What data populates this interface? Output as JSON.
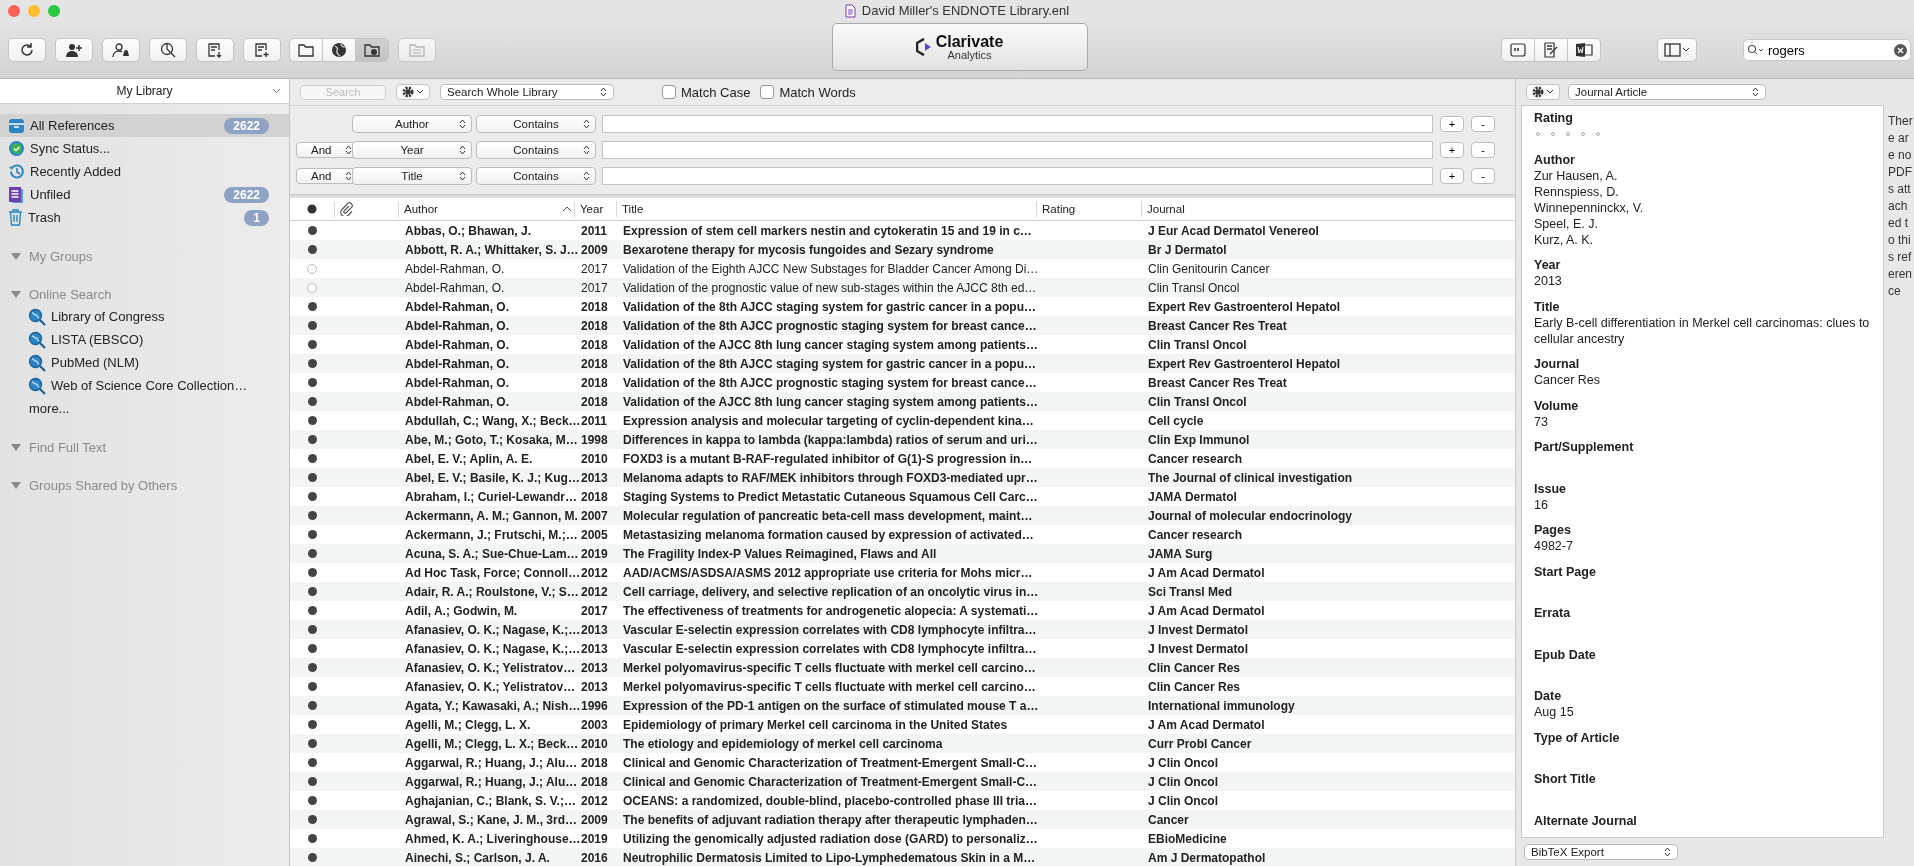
{
  "window": {
    "title": "David Miller's ENDNOTE Library.enl"
  },
  "toolbar": {
    "mode_buttons": [
      {
        "kind": "local",
        "selected": false
      },
      {
        "kind": "online",
        "selected": false
      },
      {
        "kind": "integrated",
        "selected": true
      }
    ],
    "logo": {
      "line1": "Clarivate",
      "line2": "Analytics"
    },
    "search": {
      "value": "rogers"
    }
  },
  "sidebar": {
    "library": "My Library",
    "items": [
      {
        "kind": "all",
        "label": "All References",
        "count": "2622",
        "selected": true
      },
      {
        "kind": "sync",
        "label": "Sync Status...",
        "selected": false
      },
      {
        "kind": "recent",
        "label": "Recently Added",
        "selected": false
      },
      {
        "kind": "unfiled",
        "label": "Unfiled",
        "count": "2622",
        "selected": false
      },
      {
        "kind": "trash",
        "label": "Trash",
        "count": "1",
        "selected": false
      }
    ],
    "groups": [
      {
        "title": "My Groups",
        "expanded": true
      },
      {
        "title": "Online Search",
        "expanded": true,
        "items": [
          {
            "kind": "source",
            "label": "Library of Congress"
          },
          {
            "kind": "source",
            "label": "LISTA (EBSCO)"
          },
          {
            "kind": "source",
            "label": "PubMed (NLM)"
          },
          {
            "kind": "source",
            "label": "Web of Science Core Collection…"
          },
          {
            "kind": "more",
            "label": "more..."
          }
        ]
      },
      {
        "title": "Find Full Text",
        "expanded": true
      },
      {
        "title": "Groups Shared by Others",
        "expanded": true
      }
    ]
  },
  "search_panel": {
    "quick_search": {
      "placeholder": "Search",
      "disabled": true
    },
    "scope": "Search Whole Library",
    "options": [
      {
        "label": "Match Case",
        "checked": false
      },
      {
        "label": "Match Words",
        "checked": false
      }
    ],
    "criteria": [
      {
        "field": "Author",
        "operator": "Contains",
        "add": "+",
        "remove": "-"
      },
      {
        "connector": "And",
        "field": "Year",
        "operator": "Contains",
        "add": "+",
        "remove": "-"
      },
      {
        "connector": "And",
        "field": "Title",
        "operator": "Contains",
        "add": "+",
        "remove": "-"
      }
    ]
  },
  "table": {
    "columns": [
      {
        "label": "Author",
        "sorted": true
      },
      {
        "label": "Year",
        "sorted": false
      },
      {
        "label": "Title",
        "sorted": false
      },
      {
        "label": "Rating",
        "sorted": false
      },
      {
        "label": "Journal",
        "sorted": false
      }
    ],
    "rows": [
      {
        "read": false,
        "author": "Abbas, O.; Bhawan, J.",
        "year": "2011",
        "title": "Expression of stem cell markers nestin and cytokeratin 15 and 19 in c…",
        "journal": "J Eur Acad Dermatol Venereol"
      },
      {
        "read": false,
        "author": "Abbott, R. A.; Whittaker, S. J…",
        "year": "2009",
        "title": "Bexarotene therapy for mycosis fungoides and Sezary syndrome",
        "journal": "Br J Dermatol"
      },
      {
        "read": true,
        "author": "Abdel-Rahman, O.",
        "year": "2017",
        "title": "Validation of the Eighth AJCC New Substages for Bladder Cancer Among Di…",
        "journal": "Clin Genitourin Cancer"
      },
      {
        "read": true,
        "author": "Abdel-Rahman, O.",
        "year": "2017",
        "title": "Validation of the prognostic value of new sub-stages within the AJCC 8th ed…",
        "journal": "Clin Transl Oncol"
      },
      {
        "read": false,
        "author": "Abdel-Rahman, O.",
        "year": "2018",
        "title": "Validation of the 8th AJCC staging system for gastric cancer in a popu…",
        "journal": "Expert Rev Gastroenterol Hepatol"
      },
      {
        "read": false,
        "author": "Abdel-Rahman, O.",
        "year": "2018",
        "title": "Validation of the 8th AJCC prognostic staging system for breast cance…",
        "journal": "Breast Cancer Res Treat"
      },
      {
        "read": false,
        "author": "Abdel-Rahman, O.",
        "year": "2018",
        "title": "Validation of the AJCC 8th lung cancer staging system among patients…",
        "journal": "Clin Transl Oncol"
      },
      {
        "read": false,
        "author": "Abdel-Rahman, O.",
        "year": "2018",
        "title": "Validation of the 8th AJCC staging system for gastric cancer in a popu…",
        "journal": "Expert Rev Gastroenterol Hepatol"
      },
      {
        "read": false,
        "author": "Abdel-Rahman, O.",
        "year": "2018",
        "title": "Validation of the 8th AJCC prognostic staging system for breast cance…",
        "journal": "Breast Cancer Res Treat"
      },
      {
        "read": false,
        "author": "Abdel-Rahman, O.",
        "year": "2018",
        "title": "Validation of the AJCC 8th lung cancer staging system among patients…",
        "journal": "Clin Transl Oncol"
      },
      {
        "read": false,
        "author": "Abdullah, C.; Wang, X.; Beck…",
        "year": "2011",
        "title": "Expression analysis and molecular targeting of cyclin-dependent kina…",
        "journal": "Cell cycle"
      },
      {
        "read": false,
        "author": "Abe, M.; Goto, T.; Kosaka, M…",
        "year": "1998",
        "title": "Differences in kappa to lambda (kappa:lambda) ratios of serum and uri…",
        "journal": "Clin Exp Immunol"
      },
      {
        "read": false,
        "author": "Abel, E. V.; Aplin, A. E.",
        "year": "2010",
        "title": "FOXD3 is a mutant B-RAF-regulated inhibitor of G(1)-S progression in…",
        "journal": "Cancer research"
      },
      {
        "read": false,
        "author": "Abel, E. V.; Basile, K. J.; Kug…",
        "year": "2013",
        "title": "Melanoma adapts to RAF/MEK inhibitors through FOXD3-mediated upr…",
        "journal": "The Journal of clinical investigation"
      },
      {
        "read": false,
        "author": "Abraham, I.; Curiel-Lewandr…",
        "year": "2018",
        "title": "Staging Systems to Predict Metastatic Cutaneous Squamous Cell Carc…",
        "journal": "JAMA Dermatol"
      },
      {
        "read": false,
        "author": "Ackermann, A. M.; Gannon, M.",
        "year": "2007",
        "title": "Molecular regulation of pancreatic beta-cell mass development, maint…",
        "journal": "Journal of molecular endocrinology"
      },
      {
        "read": false,
        "author": "Ackermann, J.; Frutschi, M.;…",
        "year": "2005",
        "title": "Metastasizing melanoma formation caused by expression of activated…",
        "journal": "Cancer research"
      },
      {
        "read": false,
        "author": "Acuna, S. A.; Sue-Chue-Lam…",
        "year": "2019",
        "title": "The Fragility Index-P Values Reimagined, Flaws and All",
        "journal": "JAMA Surg"
      },
      {
        "read": false,
        "author": "Ad Hoc Task, Force; Connoll…",
        "year": "2012",
        "title": "AAD/ACMS/ASDSA/ASMS 2012 appropriate use criteria for Mohs micr…",
        "journal": "J Am Acad Dermatol"
      },
      {
        "read": false,
        "author": "Adair, R. A.; Roulstone, V.; S…",
        "year": "2012",
        "title": "Cell carriage, delivery, and selective replication of an oncolytic virus in…",
        "journal": "Sci Transl Med"
      },
      {
        "read": false,
        "author": "Adil, A.; Godwin, M.",
        "year": "2017",
        "title": "The effectiveness of treatments for androgenetic alopecia: A systemati…",
        "journal": "J Am Acad Dermatol"
      },
      {
        "read": false,
        "author": "Afanasiev, O. K.; Nagase, K.;…",
        "year": "2013",
        "title": "Vascular E-selectin expression correlates with CD8 lymphocyte infiltra…",
        "journal": "J Invest Dermatol"
      },
      {
        "read": false,
        "author": "Afanasiev, O. K.; Nagase, K.;…",
        "year": "2013",
        "title": "Vascular E-selectin expression correlates with CD8 lymphocyte infiltra…",
        "journal": "J Invest Dermatol"
      },
      {
        "read": false,
        "author": "Afanasiev, O. K.; Yelistratov…",
        "year": "2013",
        "title": "Merkel polyomavirus-specific T cells fluctuate with merkel cell carcino…",
        "journal": "Clin Cancer Res"
      },
      {
        "read": false,
        "author": "Afanasiev, O. K.; Yelistratov…",
        "year": "2013",
        "title": "Merkel polyomavirus-specific T cells fluctuate with merkel cell carcino…",
        "journal": "Clin Cancer Res"
      },
      {
        "read": false,
        "author": "Agata, Y.; Kawasaki, A.; Nish…",
        "year": "1996",
        "title": "Expression of the PD-1 antigen on the surface of stimulated mouse T a…",
        "journal": "International immunology"
      },
      {
        "read": false,
        "author": "Agelli, M.; Clegg, L. X.",
        "year": "2003",
        "title": "Epidemiology of primary Merkel cell carcinoma in the United States",
        "journal": "J Am Acad Dermatol"
      },
      {
        "read": false,
        "author": "Agelli, M.; Clegg, L. X.; Beck…",
        "year": "2010",
        "title": "The etiology and epidemiology of merkel cell carcinoma",
        "journal": "Curr Probl Cancer"
      },
      {
        "read": false,
        "author": "Aggarwal, R.; Huang, J.; Alu…",
        "year": "2018",
        "title": "Clinical and Genomic Characterization of Treatment-Emergent Small-C…",
        "journal": "J Clin Oncol"
      },
      {
        "read": false,
        "author": "Aggarwal, R.; Huang, J.; Alu…",
        "year": "2018",
        "title": "Clinical and Genomic Characterization of Treatment-Emergent Small-C…",
        "journal": "J Clin Oncol"
      },
      {
        "read": false,
        "author": "Aghajanian, C.; Blank, S. V.;…",
        "year": "2012",
        "title": "OCEANS: a randomized, double-blind, placebo-controlled phase III tria…",
        "journal": "J Clin Oncol"
      },
      {
        "read": false,
        "author": "Agrawal, S.; Kane, J. M., 3rd…",
        "year": "2009",
        "title": "The benefits of adjuvant radiation therapy after therapeutic lymphaden…",
        "journal": "Cancer"
      },
      {
        "read": false,
        "author": "Ahmed, K. A.; Liveringhouse…",
        "year": "2019",
        "title": "Utilizing the genomically adjusted radiation dose (GARD) to personaliz…",
        "journal": "EBioMedicine"
      },
      {
        "read": false,
        "author": "Ainechi, S.; Carlson, J. A.",
        "year": "2016",
        "title": "Neutrophilic Dermatosis Limited to Lipo-Lymphedematous Skin in a M…",
        "journal": "Am J Dermatopathol"
      }
    ]
  },
  "reference": {
    "type": "Journal Article",
    "fields": [
      {
        "kind": "rating",
        "label": "Rating",
        "stars": 0
      },
      {
        "kind": "text",
        "label": "Author",
        "values": [
          "Zur Hausen, A.",
          "Rennspiess, D.",
          "Winnepenninckx, V.",
          "Speel, E. J.",
          "Kurz, A. K."
        ]
      },
      {
        "kind": "text",
        "label": "Year",
        "values": [
          "2013"
        ]
      },
      {
        "kind": "text",
        "label": "Title",
        "values": [
          "Early B-cell differentiation in Merkel cell carcinomas: clues to cellular ancestry"
        ]
      },
      {
        "kind": "text",
        "label": "Journal",
        "values": [
          "Cancer Res"
        ]
      },
      {
        "kind": "text",
        "label": "Volume",
        "values": [
          "73"
        ]
      },
      {
        "kind": "text",
        "label": "Part/Supplement"
      },
      {
        "kind": "text",
        "label": "Issue",
        "values": [
          "16"
        ]
      },
      {
        "kind": "text",
        "label": "Pages",
        "values": [
          "4982-7"
        ]
      },
      {
        "kind": "text",
        "label": "Start Page"
      },
      {
        "kind": "text",
        "label": "Errata"
      },
      {
        "kind": "text",
        "label": "Epub Date"
      },
      {
        "kind": "text",
        "label": "Date",
        "values": [
          "Aug 15"
        ]
      },
      {
        "kind": "text",
        "label": "Type of Article"
      },
      {
        "kind": "text",
        "label": "Short Title"
      },
      {
        "kind": "text",
        "label": "Alternate Journal"
      }
    ],
    "output_style": "BibTeX Export"
  },
  "pdf_note": "There are no PDFs attached to this reference"
}
